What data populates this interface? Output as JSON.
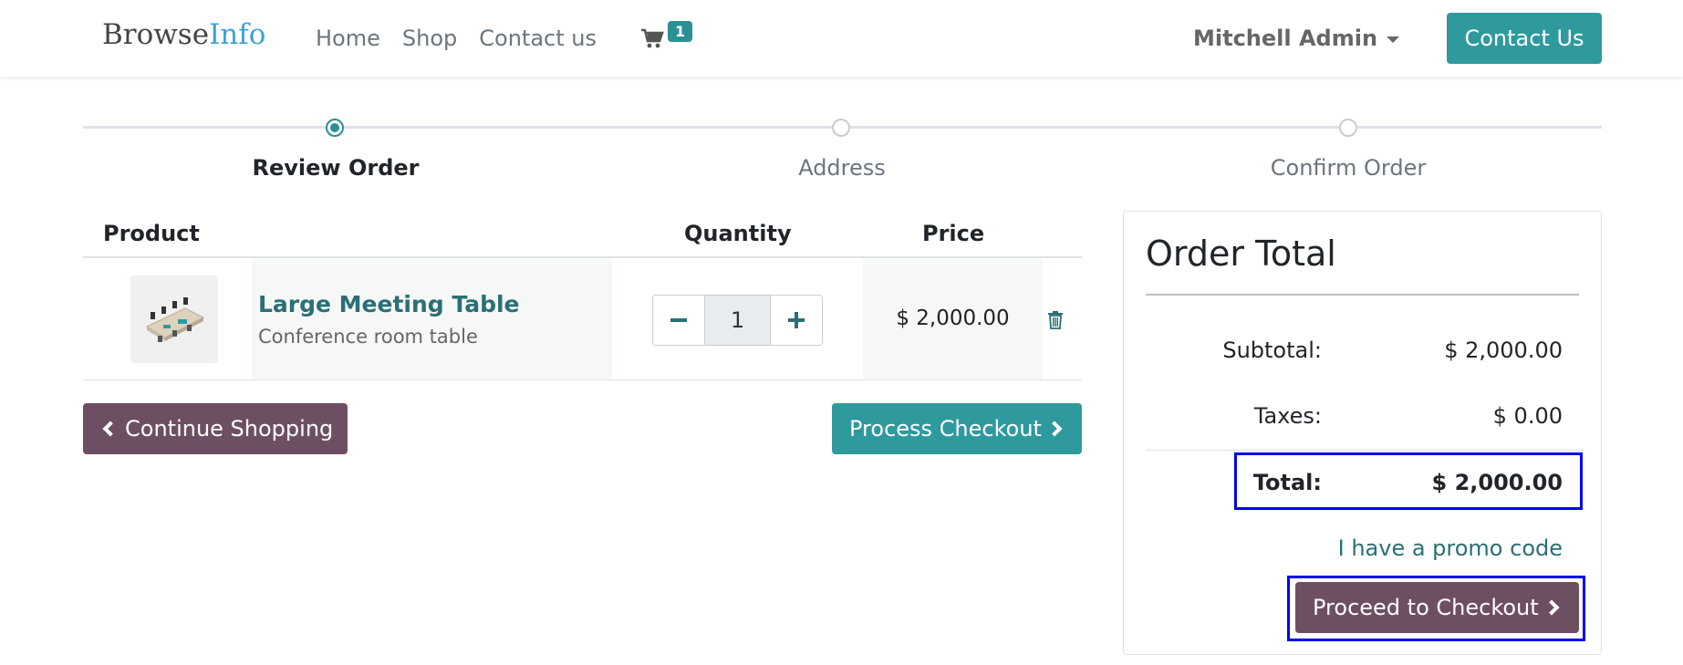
{
  "header": {
    "brand_primary": "Browse",
    "brand_accent": "Info",
    "nav": [
      "Home",
      "Shop",
      "Contact us"
    ],
    "cart_count": "1",
    "user_name": "Mitchell Admin",
    "contact_button": "Contact Us"
  },
  "wizard": {
    "steps": [
      "Review Order",
      "Address",
      "Confirm Order"
    ],
    "active_step": 0
  },
  "cart": {
    "columns": [
      "Product",
      "Quantity",
      "Price"
    ],
    "items": [
      {
        "name": "Large Meeting Table",
        "description": "Conference room table",
        "quantity": "1",
        "price": "$ 2,000.00"
      }
    ],
    "continue_label": "Continue Shopping",
    "process_label": "Process Checkout"
  },
  "order_total": {
    "title": "Order Total",
    "subtotal_label": "Subtotal:",
    "subtotal_value": "$ 2,000.00",
    "taxes_label": "Taxes:",
    "taxes_value": "$ 0.00",
    "total_label": "Total:",
    "total_value": "$ 2,000.00",
    "promo_link": "I have a promo code",
    "proceed_label": "Proceed to Checkout"
  },
  "icons": {
    "cart": "shopping-cart-icon",
    "trash": "trash-icon",
    "minus": "minus-icon",
    "plus": "plus-icon"
  },
  "colors": {
    "teal": "#2e9a9e",
    "plum": "#6d4f64",
    "highlight": "#0000ee"
  }
}
